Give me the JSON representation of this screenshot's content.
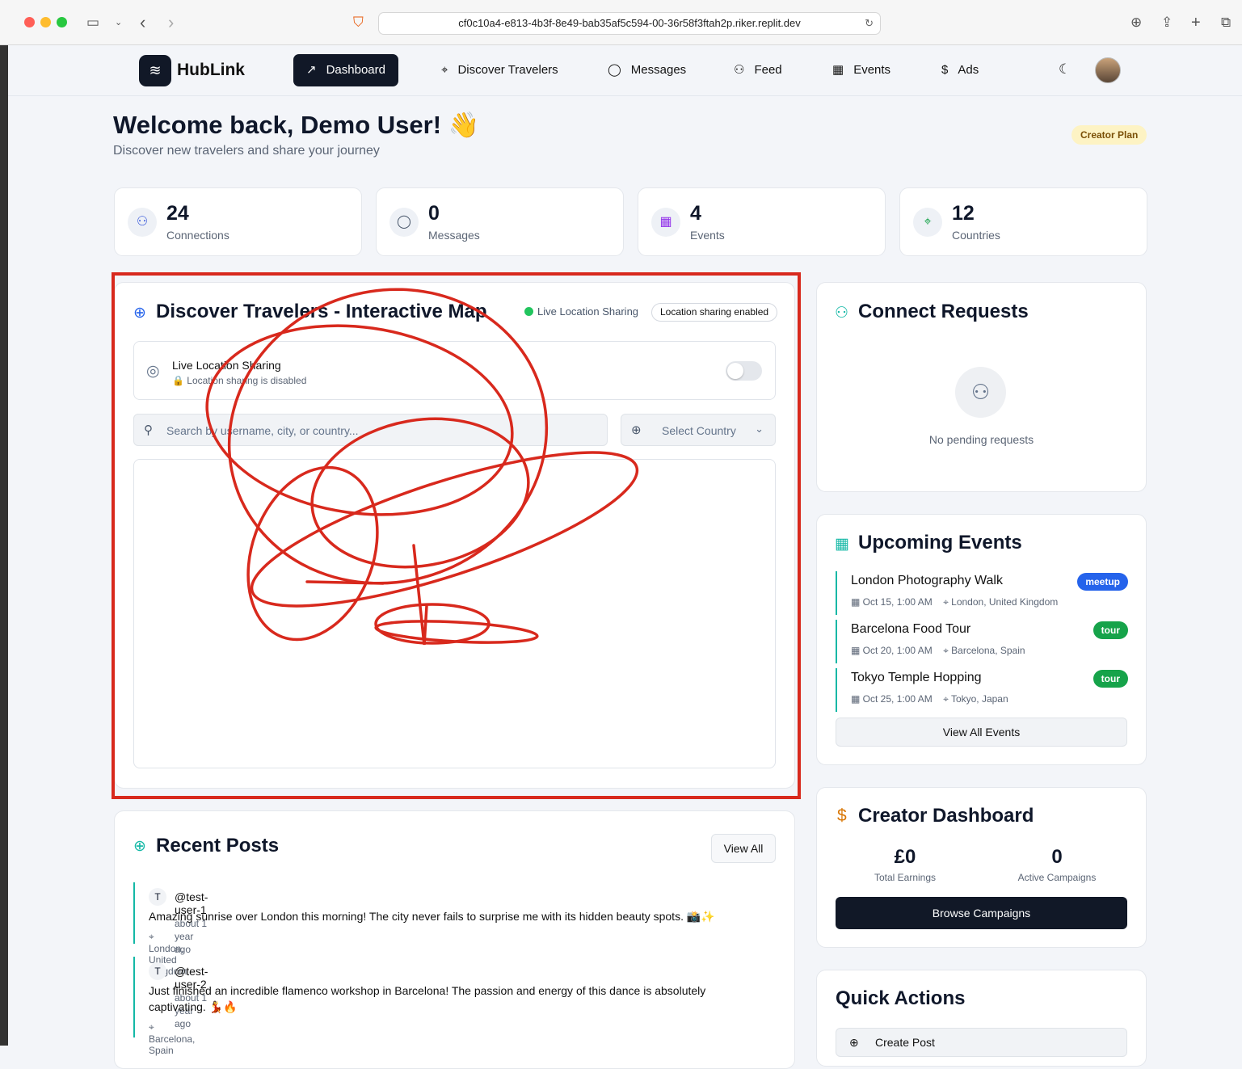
{
  "browser": {
    "url": "cf0c10a4-e813-4b3f-8e49-bab35af5c594-00-36r58f3ftah2p.riker.replit.dev"
  },
  "nav": {
    "brand": "HubLink",
    "items": [
      {
        "label": "Dashboard",
        "icon": "trending-up-icon"
      },
      {
        "label": "Discover Travelers",
        "icon": "map-pin-icon"
      },
      {
        "label": "Messages",
        "icon": "message-circle-icon"
      },
      {
        "label": "Feed",
        "icon": "users-icon"
      },
      {
        "label": "Events",
        "icon": "calendar-icon"
      },
      {
        "label": "Ads",
        "icon": "dollar-sign-icon"
      }
    ]
  },
  "header": {
    "title": "Welcome back, Demo User! 👋",
    "subtitle": "Discover new travelers and share your journey",
    "plan_badge": "Creator Plan"
  },
  "stats": [
    {
      "value": "24",
      "label": "Connections",
      "color": "#3b5bdb"
    },
    {
      "value": "0",
      "label": "Messages",
      "color": "#475569"
    },
    {
      "value": "4",
      "label": "Events",
      "color": "#9333ea"
    },
    {
      "value": "12",
      "label": "Countries",
      "color": "#16a34a"
    }
  ],
  "map_card": {
    "title": "Discover Travelers - Interactive Map",
    "live_status": "Live Location Sharing",
    "sharing_badge": "Location sharing enabled",
    "toggle_title": "Live Location Sharing",
    "toggle_sub": "🔒 Location sharing is disabled",
    "search_placeholder": "Search by username, city, or country...",
    "country_select": "Select Country"
  },
  "connect": {
    "title": "Connect Requests",
    "empty": "No pending requests"
  },
  "events": {
    "title": "Upcoming Events",
    "items": [
      {
        "title": "London Photography Walk",
        "date": "Oct 15, 1:00 AM",
        "location": "London, United Kingdom",
        "tag": "meetup",
        "tag_color": "#2563eb"
      },
      {
        "title": "Barcelona Food Tour",
        "date": "Oct 20, 1:00 AM",
        "location": "Barcelona, Spain",
        "tag": "tour",
        "tag_color": "#16a34a"
      },
      {
        "title": "Tokyo Temple Hopping",
        "date": "Oct 25, 1:00 AM",
        "location": "Tokyo, Japan",
        "tag": "tour",
        "tag_color": "#16a34a"
      }
    ],
    "view_all": "View All Events"
  },
  "creator": {
    "title": "Creator Dashboard",
    "earnings": "£0",
    "earnings_label": "Total Earnings",
    "campaigns": "0",
    "campaigns_label": "Active Campaigns",
    "browse": "Browse Campaigns"
  },
  "quick": {
    "title": "Quick Actions",
    "create_post": "Create Post"
  },
  "posts": {
    "title": "Recent Posts",
    "view_all": "View All",
    "items": [
      {
        "initial": "T",
        "user": "@test-user-1",
        "time": "about 1 year ago",
        "text": "Amazing sunrise over London this morning! The city never fails to surprise me with its hidden beauty spots. 📸✨",
        "location": "London, United Kingdom"
      },
      {
        "initial": "T",
        "user": "@test-user-2",
        "time": "about 1 year ago",
        "text": "Just finished an incredible flamenco workshop in Barcelona! The passion and energy of this dance is absolutely captivating. 💃🔥",
        "location": "Barcelona, Spain"
      }
    ]
  }
}
